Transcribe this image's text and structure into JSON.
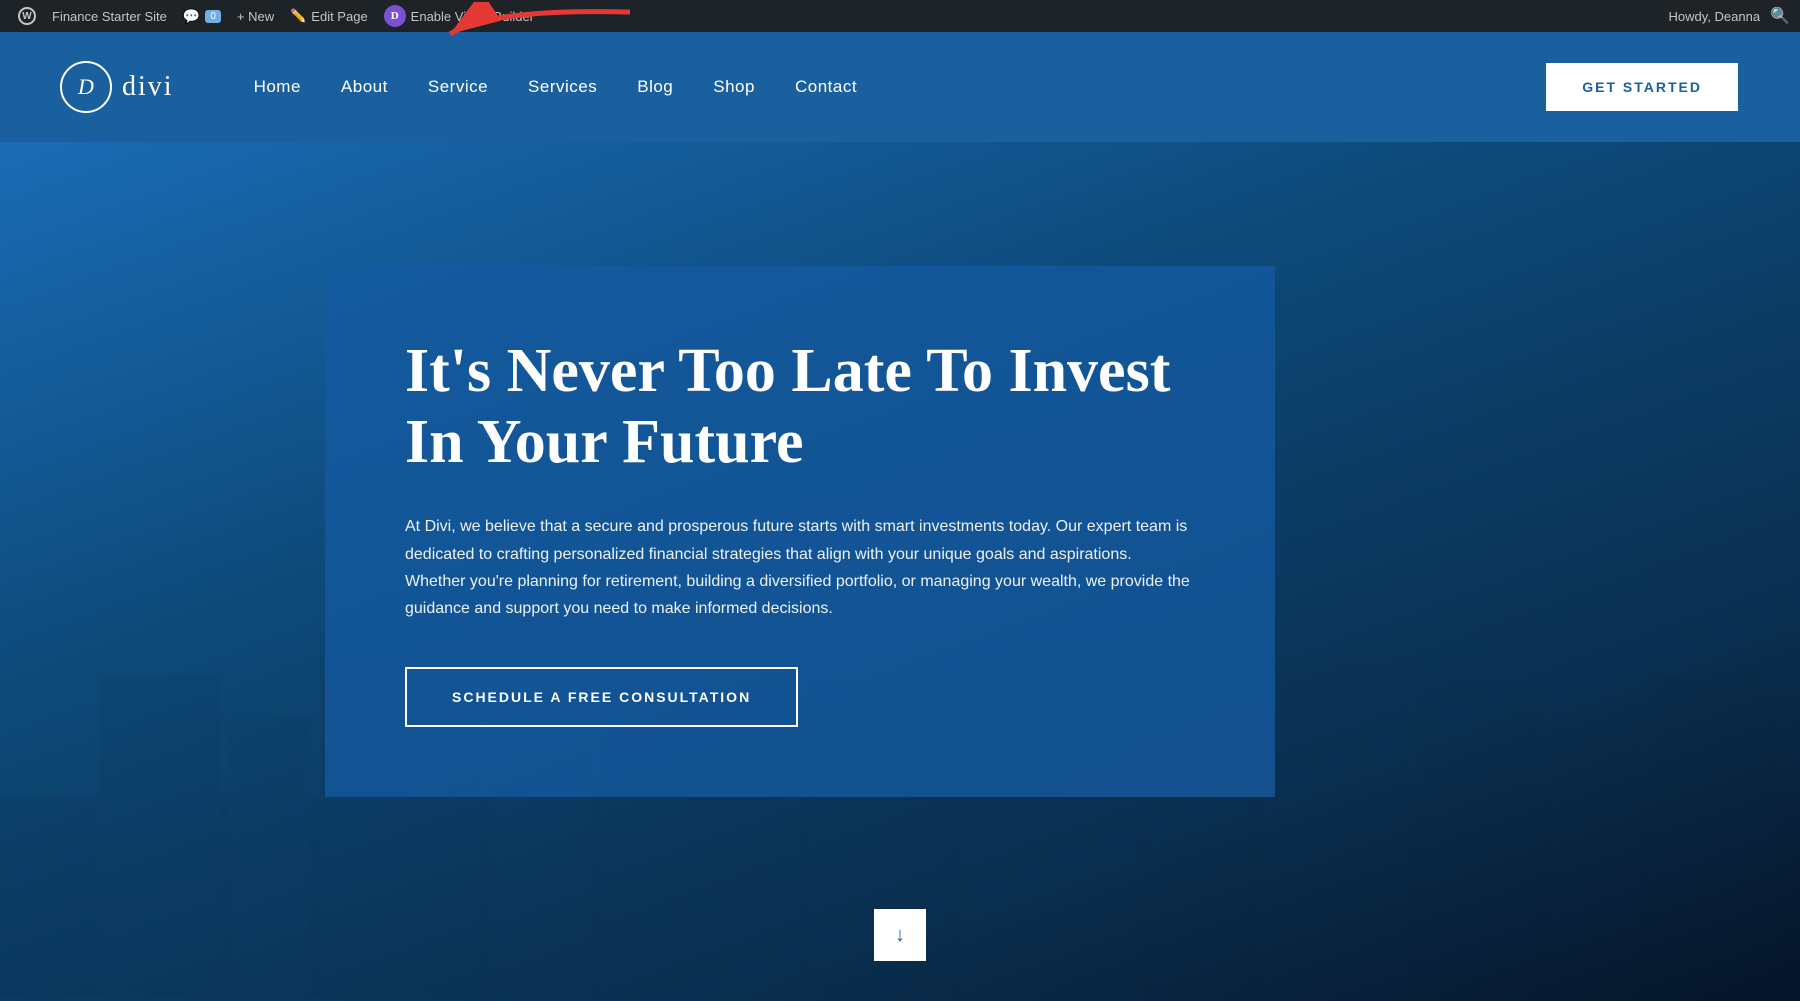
{
  "adminBar": {
    "siteName": "Finance Starter Site",
    "commentCount": "0",
    "newLabel": "+ New",
    "editPageLabel": "Edit Page",
    "enableBuilderLabel": "Enable Visual Builder",
    "howdyText": "Howdy, Deanna"
  },
  "header": {
    "logoLetter": "D",
    "logoText": "divi",
    "nav": [
      {
        "label": "Home"
      },
      {
        "label": "About"
      },
      {
        "label": "Service"
      },
      {
        "label": "Services"
      },
      {
        "label": "Blog"
      },
      {
        "label": "Shop"
      },
      {
        "label": "Contact"
      }
    ],
    "ctaButton": "GET STARTED"
  },
  "hero": {
    "title": "It's Never Too Late To Invest In Your Future",
    "description": "At Divi, we believe that a secure and prosperous future starts with smart investments today. Our expert team is dedicated to crafting personalized financial strategies that align with your unique goals and aspirations. Whether you're planning for retirement, building a diversified portfolio, or managing your wealth, we provide the guidance and support you need to make informed decisions.",
    "ctaButton": "SCHEDULE A FREE CONSULTATION",
    "downArrow": "↓"
  },
  "colors": {
    "adminBarBg": "#1d2327",
    "headerBg": "#1a5f9e",
    "heroCardBg": "rgba(20,90,160,0.78)",
    "ctaButtonBg": "transparent",
    "getStartedBg": "#fff"
  }
}
